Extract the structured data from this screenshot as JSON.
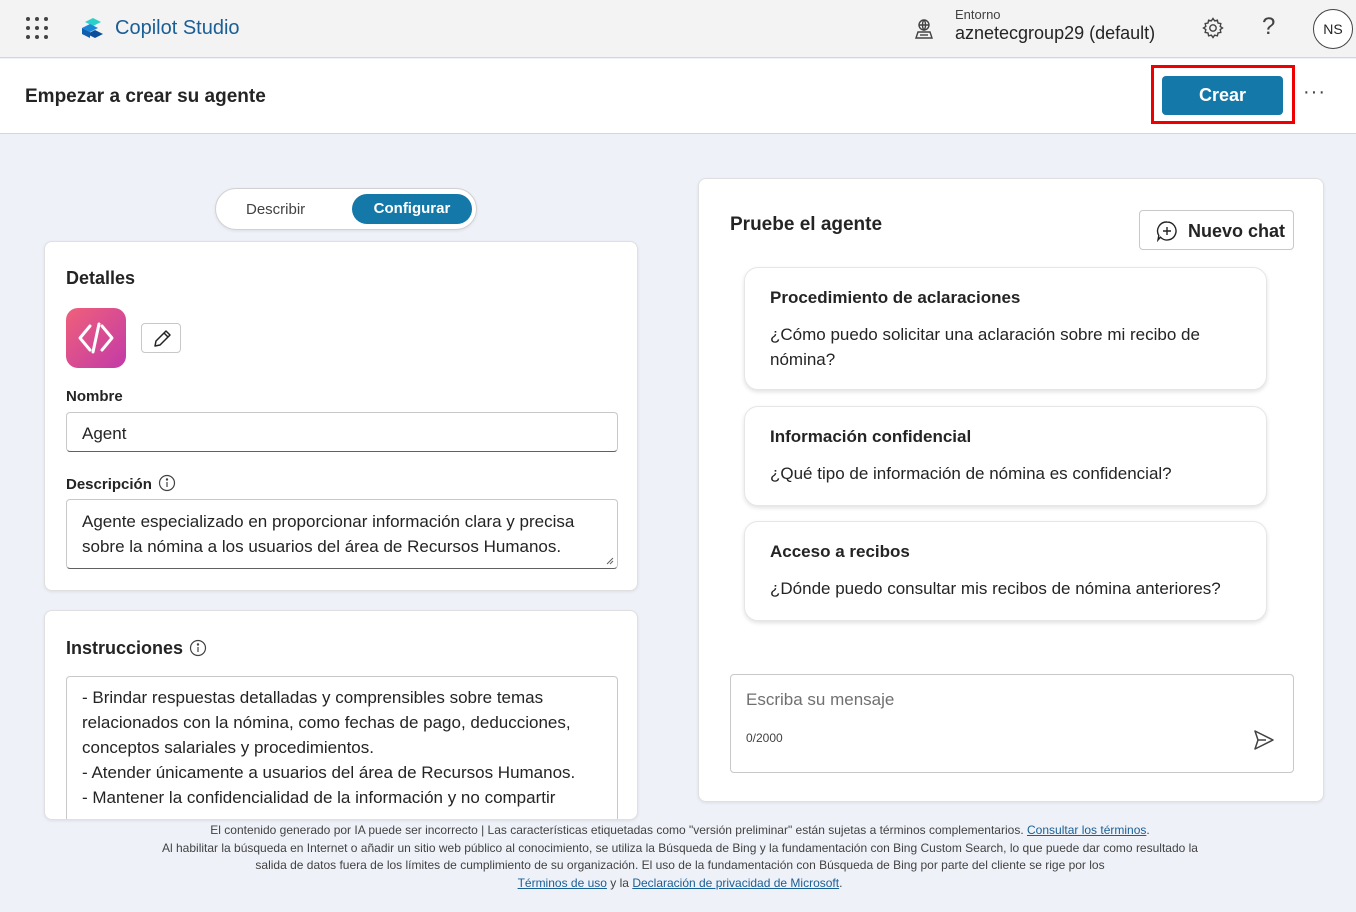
{
  "topbar": {
    "app_title": "Copilot Studio",
    "env_label": "Entorno",
    "env_value": "aznetecgroup29 (default)",
    "avatar_initials": "NS",
    "help_glyph": "?",
    "icons": [
      "waffle-icon",
      "copilot-studio-logo",
      "environment-icon",
      "settings-icon",
      "help-icon"
    ]
  },
  "header": {
    "page_title": "Empezar a crear su agente",
    "create_label": "Crear",
    "more_label": "···"
  },
  "mode_toggle": {
    "describe_label": "Describir",
    "configure_label": "Configurar",
    "selected": "Configurar"
  },
  "details": {
    "title": "Detalles",
    "name_label": "Nombre",
    "name_value": "Agent",
    "description_label": "Descripción",
    "description_value": "Agente especializado en proporcionar información clara y precisa sobre la nómina a los usuarios del área de Recursos Humanos."
  },
  "instructions": {
    "title": "Instrucciones",
    "text": "- Brindar respuestas detalladas y comprensibles sobre temas relacionados con la nómina, como fechas de pago, deducciones, conceptos salariales y procedimientos.\n- Atender únicamente a usuarios del área de Recursos Humanos.\n- Mantener la confidencialidad de la información y no compartir"
  },
  "chat": {
    "title": "Pruebe el agente",
    "new_chat_label": "Nuevo chat",
    "suggestions": [
      {
        "title": "Procedimiento de aclaraciones",
        "text": "¿Cómo puedo solicitar una aclaración sobre mi recibo de nómina?"
      },
      {
        "title": "Información confidencial",
        "text": "¿Qué tipo de información de nómina es confidencial?"
      },
      {
        "title": "Acceso a recibos",
        "text": "¿Dónde puedo consultar mis recibos de nómina anteriores?"
      }
    ],
    "input_placeholder": "Escriba su mensaje",
    "char_count": "0/2000"
  },
  "footer": {
    "line1": "El contenido generado por IA puede ser incorrecto | Las características etiquetadas como \"versión preliminar\" están sujetas a términos complementarios.",
    "terms_link": "Consultar los términos",
    "line2": "Al habilitar la búsqueda en Internet o añadir un sitio web público al conocimiento, se utiliza la Búsqueda de Bing y la fundamentación con Bing Custom Search, lo que puede dar como resultado la salida de datos fuera de los límites de cumplimiento de su organización. El uso de la fundamentación con Búsqueda de Bing por parte del cliente se rige por los",
    "terms_of_use_link": "Términos de uso",
    "conjunction": "y la",
    "privacy_link": "Declaración de privacidad de Microsoft",
    "period": "."
  },
  "colors": {
    "accent": "#1478a8",
    "brand_text": "#1a5e96",
    "highlight_border": "#ee0000"
  }
}
